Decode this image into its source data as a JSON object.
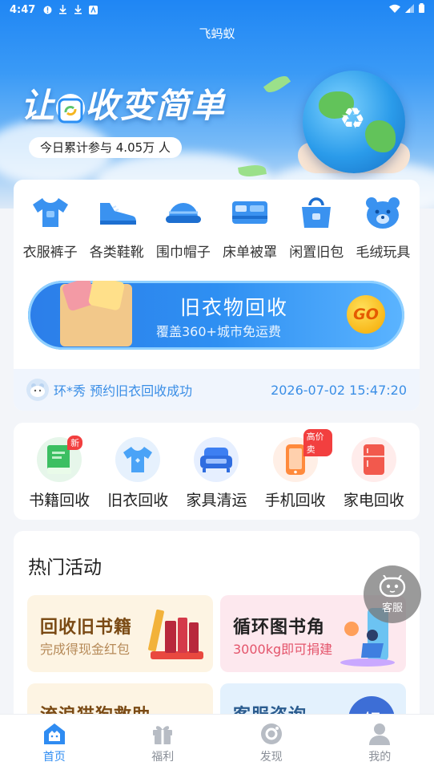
{
  "status_bar": {
    "time": "4:47"
  },
  "app": {
    "title": "飞蚂蚁"
  },
  "hero": {
    "slogan_part1": "让",
    "slogan_part2": "收变简单",
    "counter": "今日累计参与 4.05万 人"
  },
  "categories": [
    {
      "label": "衣服裤子",
      "icon": "tshirt-icon"
    },
    {
      "label": "各类鞋靴",
      "icon": "shoe-icon"
    },
    {
      "label": "围巾帽子",
      "icon": "hat-icon"
    },
    {
      "label": "床单被罩",
      "icon": "bed-icon"
    },
    {
      "label": "闲置旧包",
      "icon": "bag-icon"
    },
    {
      "label": "毛绒玩具",
      "icon": "teddy-bear-icon"
    }
  ],
  "banner": {
    "title": "旧衣物回收",
    "subtitle": "覆盖360+城市免运费",
    "go": "GO"
  },
  "ticker": {
    "text": "环*秀 预约旧衣回收成功",
    "time": "2026-07-02 15:47:20"
  },
  "services": [
    {
      "label": "书籍回收",
      "icon": "book-icon",
      "badge": "新",
      "color": "#3cbf62"
    },
    {
      "label": "旧衣回收",
      "icon": "tshirt-icon",
      "badge": "",
      "color": "#4aa3f7"
    },
    {
      "label": "家具清运",
      "icon": "sofa-icon",
      "badge": "",
      "color": "#3d7ff2"
    },
    {
      "label": "手机回收",
      "icon": "phone-icon",
      "badge": "高价卖",
      "color": "#ff8a3c"
    },
    {
      "label": "家电回收",
      "icon": "fridge-icon",
      "badge": "",
      "color": "#f2594d"
    }
  ],
  "activities": {
    "heading": "热门活动",
    "tiles": [
      {
        "title": "回收旧书籍",
        "subtitle": "完成得现金红包",
        "bg": "#fdf4e3",
        "title_color": "#7a4a14",
        "sub_color": "#b68a58"
      },
      {
        "title": "循环图书角",
        "subtitle": "3000kg即可捐建",
        "bg": "#fde8ee",
        "title_color": "#222222",
        "sub_color": "#e4546b"
      },
      {
        "title": "流浪猫狗救助",
        "subtitle": "",
        "bg": "#fdf4e3",
        "title_color": "#7a4a14",
        "sub_color": "#b68a58"
      },
      {
        "title": "客服咨询",
        "subtitle": "",
        "bg": "#e3f1fd",
        "title_color": "#2b5c8f",
        "sub_color": "#5a8ac2"
      }
    ]
  },
  "fab": {
    "label": "客服"
  },
  "nav": [
    {
      "label": "首页",
      "icon": "home-icon",
      "active": true
    },
    {
      "label": "福利",
      "icon": "gift-icon",
      "active": false
    },
    {
      "label": "发现",
      "icon": "discover-icon",
      "active": false
    },
    {
      "label": "我的",
      "icon": "user-icon",
      "active": false
    }
  ],
  "colors": {
    "primary": "#2f8cf2",
    "ticker": "#3a8ee6"
  }
}
